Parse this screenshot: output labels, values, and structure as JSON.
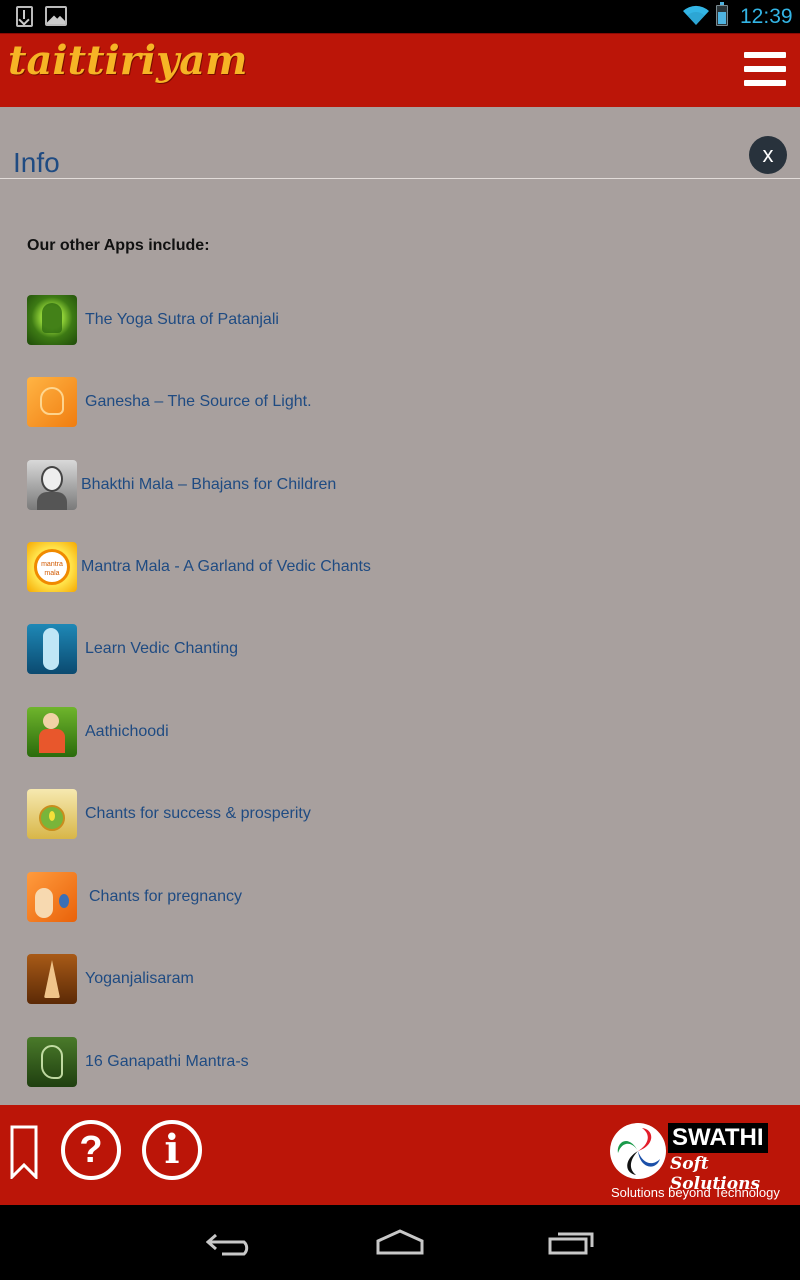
{
  "status_bar": {
    "time": "12:39",
    "icons": [
      "download-icon",
      "image-icon",
      "wifi-icon",
      "battery-icon"
    ]
  },
  "header": {
    "logo_text": "taittiriyam",
    "menu_icon": "hamburger-menu-icon"
  },
  "dialog": {
    "title": "Info",
    "close_label": "x",
    "heading": "Our other Apps include:",
    "apps": [
      {
        "label": "The Yoga Sutra of Patanjali",
        "icon": "yoga-sutra-app-icon"
      },
      {
        "label": "Ganesha – The Source of Light.",
        "icon": "ganesha-app-icon"
      },
      {
        "label": "Bhakthi Mala – Bhajans for Children",
        "icon": "bhakthi-mala-app-icon"
      },
      {
        "label": "Mantra Mala - A Garland of Vedic Chants",
        "icon": "mantra-mala-app-icon"
      },
      {
        "label": "Learn Vedic Chanting",
        "icon": "vedic-chanting-app-icon"
      },
      {
        "label": "Aathichoodi",
        "icon": "aathichoodi-app-icon"
      },
      {
        "label": "Chants for success & prosperity",
        "icon": "success-chants-app-icon"
      },
      {
        "label": "Chants for pregnancy",
        "icon": "pregnancy-chants-app-icon"
      },
      {
        "label": "Yoganjalisaram",
        "icon": "yoganjalisaram-app-icon"
      },
      {
        "label": "16 Ganapathi Mantra-s",
        "icon": "ganapathi-mantra-app-icon"
      }
    ]
  },
  "footer": {
    "help_label": "?",
    "info_label": "i",
    "brand_name": "SWATHI",
    "brand_sub": "Soft Solutions",
    "brand_tagline": "Solutions beyond Technology"
  },
  "colors": {
    "header_red": "#bb1508",
    "content_bg": "#a8a09e",
    "link_blue": "#1f4b82",
    "logo_gold": "#f6b425",
    "status_blue": "#33b5e5"
  }
}
